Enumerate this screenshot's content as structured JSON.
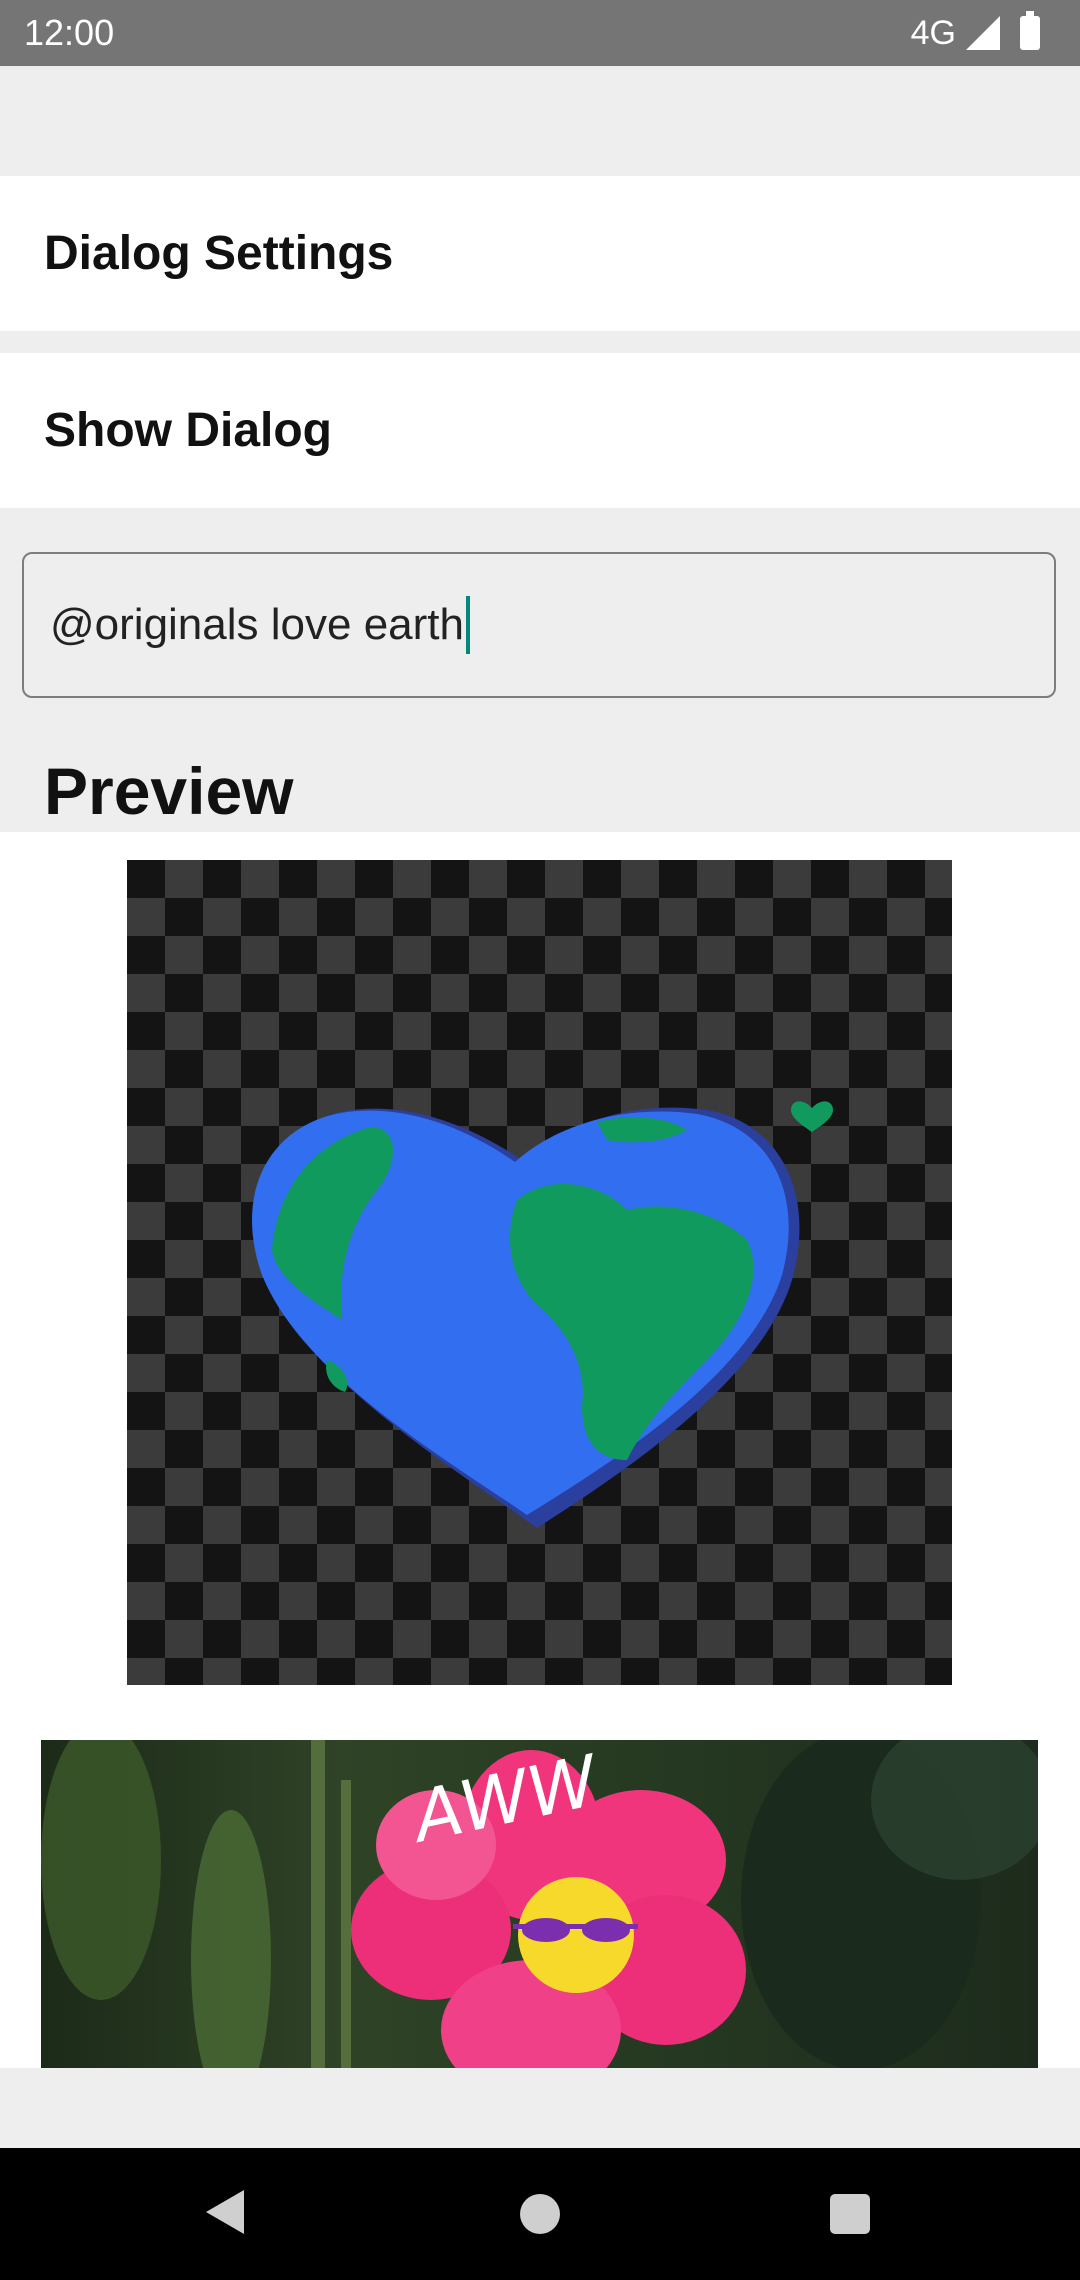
{
  "status_bar": {
    "time": "12:00",
    "network": "4G"
  },
  "rows": {
    "dialog_settings": "Dialog Settings",
    "show_dialog": "Show Dialog"
  },
  "search": {
    "value": "@originals love earth"
  },
  "preview": {
    "title": "Preview"
  },
  "gifs": [
    {
      "icon": "earth-heart-sticker"
    },
    {
      "icon": "aww-flower-gif",
      "caption": "AWW"
    }
  ],
  "colors": {
    "accent": "#00897b",
    "status_bar": "#757575",
    "earth_land": "#119a5e",
    "earth_water": "#326ef0",
    "flower": "#f0357d"
  }
}
